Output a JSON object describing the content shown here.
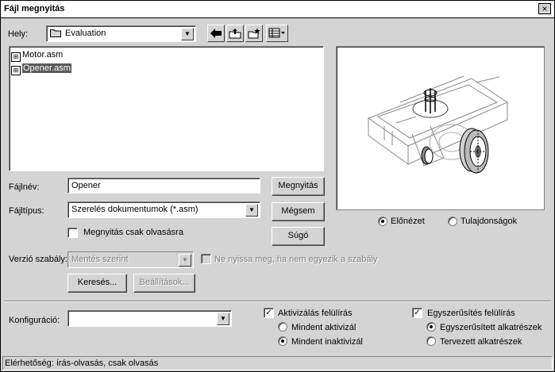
{
  "window": {
    "title": "Fájl megnyitás",
    "close_icon": "×"
  },
  "location": {
    "label": "Hely:",
    "value": "Evaluation",
    "folder_icon": "folder-icon"
  },
  "toolbar": {
    "back_icon": "back-arrow-icon",
    "up_icon": "up-folder-icon",
    "new_folder_icon": "new-folder-icon",
    "view_icon": "view-menu-icon"
  },
  "files": [
    {
      "name": "Motor.asm",
      "selected": false
    },
    {
      "name": "Opener.asm",
      "selected": true
    }
  ],
  "filename": {
    "label": "Fájlnév:",
    "value": "Opener"
  },
  "filetype": {
    "label": "Fájltípus:",
    "value": "Szerelés dokumentumok (*.asm)"
  },
  "readonly_checkbox": {
    "label": "Megnyitás csak olvasásra",
    "checked": false
  },
  "buttons": {
    "open": "Megnyitás",
    "cancel": "Mégsem",
    "help": "Súgó",
    "search": "Keresés...",
    "settings": "Beállítások..."
  },
  "version_rule": {
    "label": "Verzió szabály:",
    "value": "Mentés szerint",
    "checkbox_label": "Ne nyissa meg, ha nem egyezik a szabály"
  },
  "preview": {
    "preview_radio": "Előnézet",
    "properties_radio": "Tulajdonságok",
    "selected": "Előnézet"
  },
  "configuration": {
    "label": "Konfiguráció:",
    "value": ""
  },
  "activation": {
    "checkbox_label": "Aktivizálás felülírás",
    "checked": true,
    "options": [
      "Mindent aktivizál",
      "Mindent inaktivizál"
    ],
    "selected": "Mindent inaktivizál"
  },
  "simplification": {
    "checkbox_label": "Egyszerűsítés felülírás",
    "checked": true,
    "options": [
      "Egyszerűsített alkatrészek",
      "Tervezett alkatrészek"
    ],
    "selected": "Egyszerűsített alkatrészek"
  },
  "status": {
    "text": "Elérhetőség: írás-olvasás, csak olvasás"
  }
}
